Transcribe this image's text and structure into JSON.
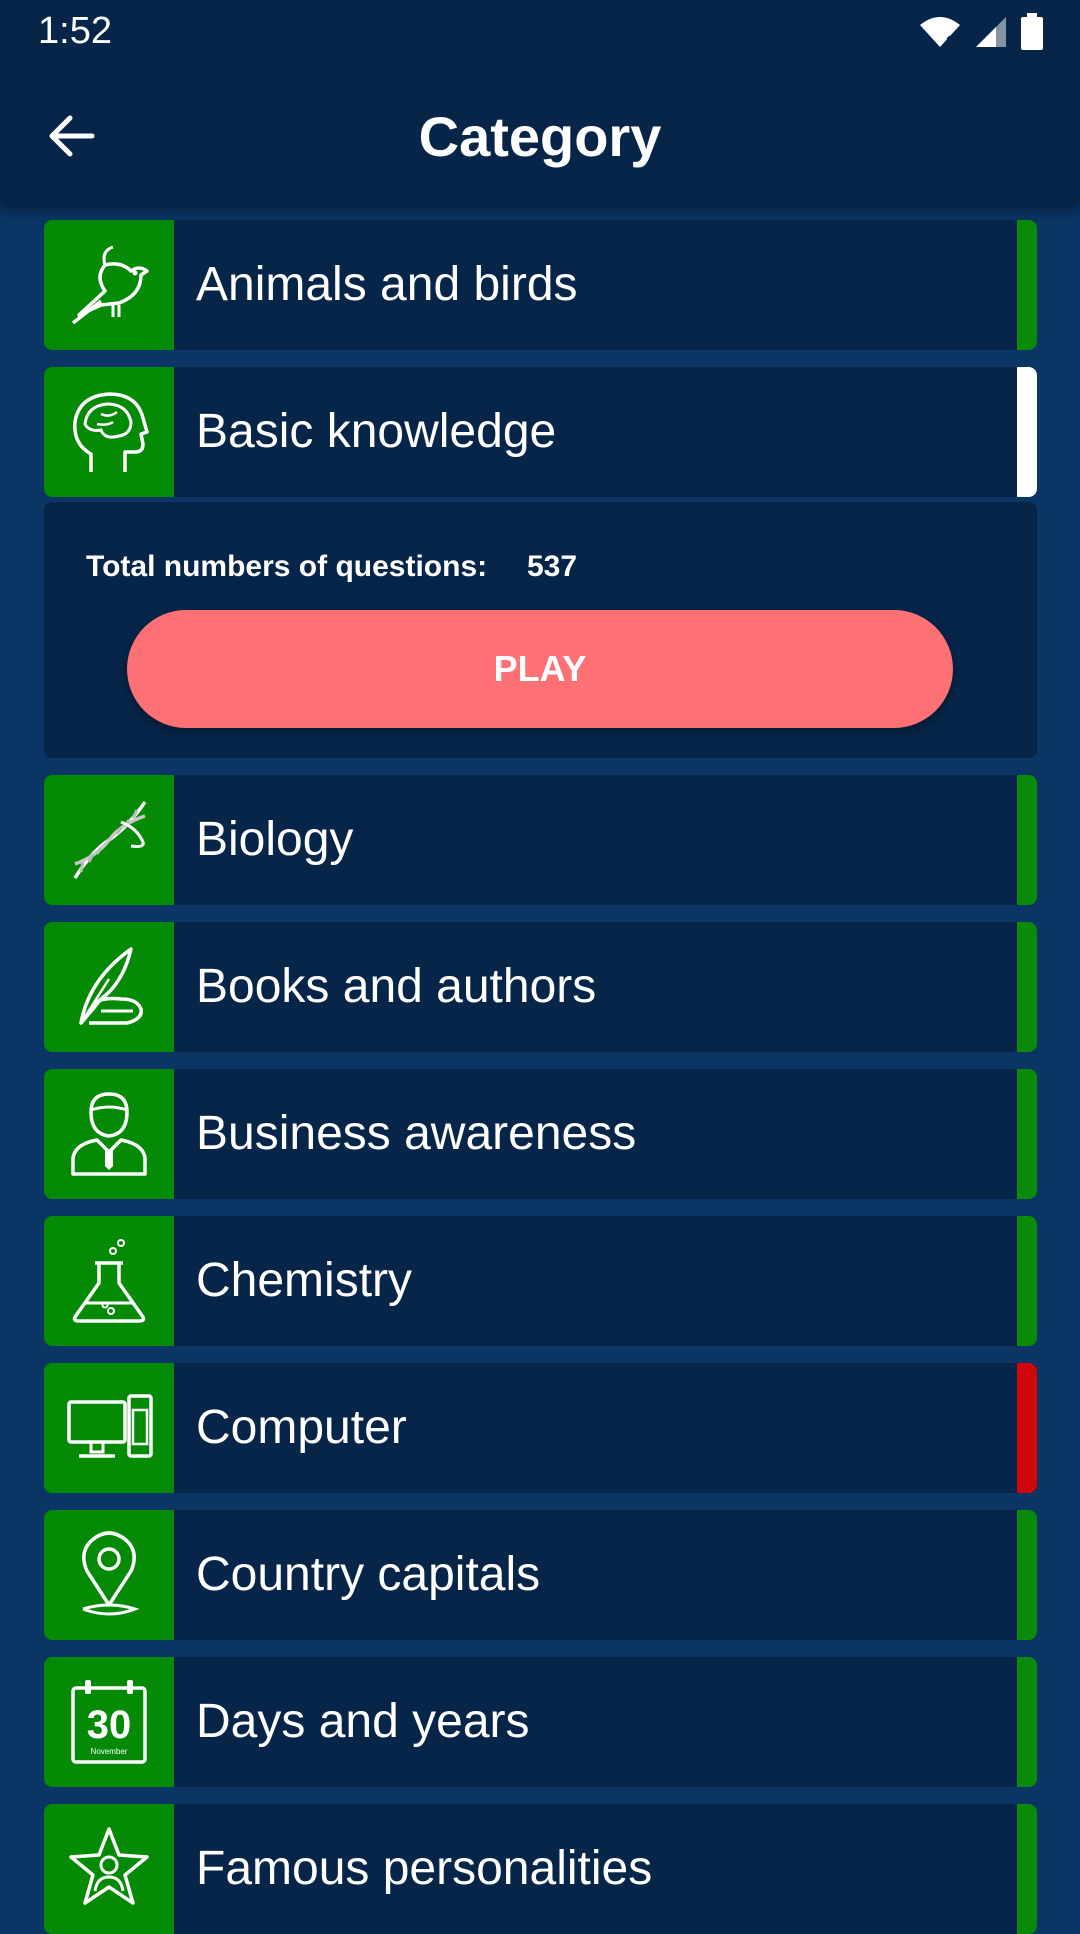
{
  "status_bar": {
    "time": "1:52"
  },
  "app_bar": {
    "title": "Category"
  },
  "colors": {
    "background": "#0a3564",
    "bar": "#062548",
    "row": "#062548",
    "icon_bg": "#048a05",
    "accent_play": "#fd7174",
    "status_green": "#0c8a0a",
    "status_red": "#d0070b",
    "status_white": "#ffffff"
  },
  "categories": [
    {
      "label": "Animals and birds",
      "icon": "bird-icon",
      "status": "green"
    },
    {
      "label": "Basic knowledge",
      "icon": "head-icon",
      "status": "white"
    },
    {
      "label": "Biology",
      "icon": "dna-icon",
      "status": "green"
    },
    {
      "label": "Books and authors",
      "icon": "quill-icon",
      "status": "green"
    },
    {
      "label": "Business awareness",
      "icon": "businessman-icon",
      "status": "green"
    },
    {
      "label": "Chemistry",
      "icon": "flask-icon",
      "status": "green"
    },
    {
      "label": "Computer",
      "icon": "computer-icon",
      "status": "red"
    },
    {
      "label": "Country capitals",
      "icon": "map-pin-icon",
      "status": "green"
    },
    {
      "label": "Days and years",
      "icon": "calendar-icon",
      "status": "green"
    },
    {
      "label": "Famous personalities",
      "icon": "star-person-icon",
      "status": "green"
    }
  ],
  "expanded": {
    "questions_label": "Total numbers of questions:",
    "questions_count": "537",
    "play_label": "PLAY"
  },
  "calendar_icon": {
    "day": "30",
    "month": "November"
  }
}
